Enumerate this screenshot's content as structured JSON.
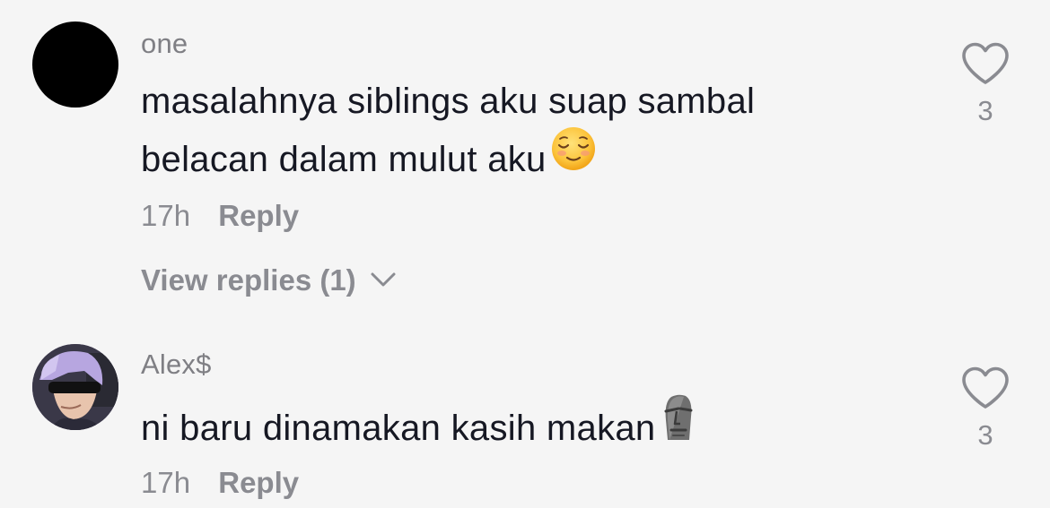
{
  "comments": [
    {
      "username": "one",
      "text": "masalahnya siblings aku suap sambal belacan dalam mulut aku",
      "emoji": "relieved-face-emoji",
      "time": "17h",
      "reply_label": "Reply",
      "view_replies_label": "View replies (1)",
      "like_count": "3"
    },
    {
      "username": "Alex$",
      "text": "ni baru dinamakan kasih makan",
      "emoji": "moai-emoji",
      "time": "17h",
      "reply_label": "Reply",
      "like_count": "3"
    }
  ],
  "colors": {
    "background": "#f5f5f5",
    "text": "#161823",
    "muted": "#8a8b91"
  }
}
